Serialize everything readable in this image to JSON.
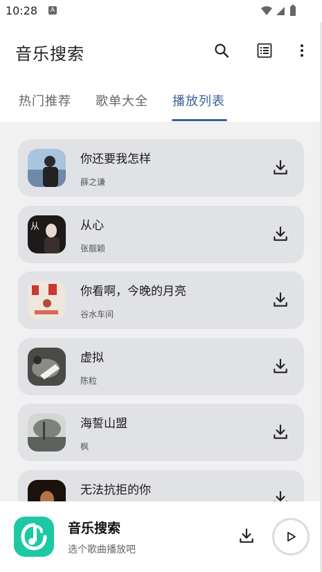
{
  "status_bar": {
    "time": "10:28",
    "notification_letter": "A"
  },
  "app_bar": {
    "title": "音乐搜索",
    "icons": [
      "search-icon",
      "list-icon",
      "more-vert-icon"
    ]
  },
  "tabs": [
    {
      "label": "热门推荐",
      "active": false
    },
    {
      "label": "歌单大全",
      "active": false
    },
    {
      "label": "播放列表",
      "active": true
    }
  ],
  "songs": [
    {
      "title": "你还要我怎样",
      "artist": "薛之谦"
    },
    {
      "title": "从心",
      "artist": "张靓颖",
      "cover_text": "从"
    },
    {
      "title": "你看啊，今晚的月亮",
      "artist": "谷水车间"
    },
    {
      "title": "虚拟",
      "artist": "陈粒"
    },
    {
      "title": "海誓山盟",
      "artist": "枫"
    },
    {
      "title": "无法抗拒的你",
      "artist": ""
    }
  ],
  "player": {
    "title": "音乐搜索",
    "subtitle": "选个歌曲播放吧",
    "accent": "#1dc9a4"
  },
  "colors": {
    "tab_active": "#3c5f99",
    "card_bg": "#e1e2e6",
    "list_bg": "#f1f1f2"
  }
}
